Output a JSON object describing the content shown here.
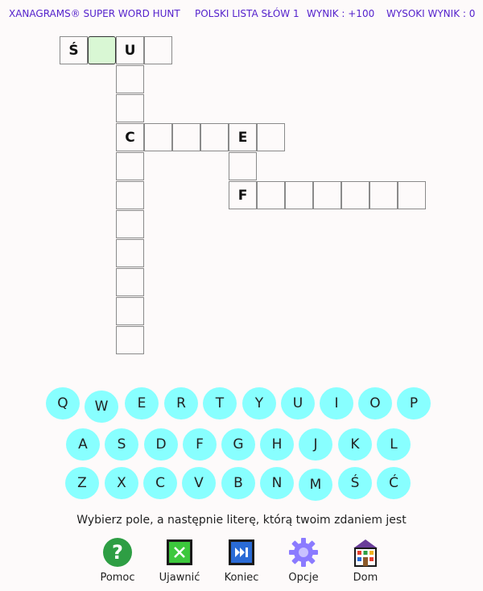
{
  "header": {
    "brand": "XANAGRAMS® SUPER WORD HUNT",
    "list": "POLSKI LISTA SŁÓW 1",
    "score": "WYNIK : +100",
    "high_score": "WYSOKI WYNIK : 0"
  },
  "cells": {
    "r0c0": "Ś",
    "r0c1": "",
    "r0c2": "U",
    "r0c3": "",
    "r1c2": "",
    "r2c2": "",
    "r3c2": "C",
    "r3c3": "",
    "r3c4": "",
    "r3c5": "",
    "r3c6": "E",
    "r3c7": "",
    "r4c2": "",
    "r4c6": "",
    "r5c2": "",
    "r5c6": "F",
    "r5c7": "",
    "r5c8": "",
    "r5c9": "",
    "r5c10": "",
    "r5c11": "",
    "r5c12": "",
    "r6c2": "",
    "r7c2": "",
    "r8c2": "",
    "r9c2": "",
    "r10c2": ""
  },
  "keyboard": {
    "row1": [
      "Q",
      "W",
      "E",
      "R",
      "T",
      "Y",
      "U",
      "I",
      "O",
      "P"
    ],
    "row2": [
      "A",
      "S",
      "D",
      "F",
      "G",
      "H",
      "J",
      "K",
      "L"
    ],
    "row3": [
      "Z",
      "X",
      "C",
      "V",
      "B",
      "N",
      "M",
      "Ś",
      "Ć"
    ]
  },
  "instruction": "Wybierz pole, a następnie literę, którą twoim zdaniem jest",
  "toolbar": {
    "help": "Pomoc",
    "reveal": "Ujawnić",
    "finish": "Koniec",
    "options": "Opcje",
    "home": "Dom"
  },
  "colors": {
    "header_text": "#5522cc",
    "key_bg": "#88ffff",
    "selected_cell": "#d9f7d4",
    "help_icon": "#2e9e44",
    "reveal_icon": "#3cc83c",
    "finish_icon": "#2a6bd6",
    "options_icon": "#8b7bff",
    "home_roof": "#6a3d9a"
  }
}
